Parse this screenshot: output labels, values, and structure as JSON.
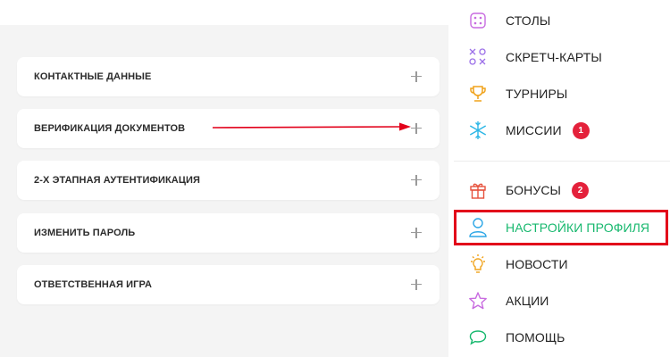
{
  "accordion": [
    {
      "label": "КОНТАКТНЫЕ ДАННЫЕ"
    },
    {
      "label": "ВЕРИФИКАЦИЯ ДОКУМЕНТОВ"
    },
    {
      "label": "2-Х ЭТАПНАЯ АУТЕНТИФИКАЦИЯ"
    },
    {
      "label": "ИЗМЕНИТЬ ПАРОЛЬ"
    },
    {
      "label": "ОТВЕТСТВЕННАЯ ИГРА"
    }
  ],
  "menu": {
    "items": [
      {
        "label": "СТОЛЫ",
        "icon": "dice-icon",
        "color": "#c86be0"
      },
      {
        "label": "СКРЕТЧ-КАРТЫ",
        "icon": "tic-tac-toe-icon",
        "color": "#9b6fe8"
      },
      {
        "label": "ТУРНИРЫ",
        "icon": "trophy-icon",
        "color": "#f0a21a"
      },
      {
        "label": "МИССИИ",
        "icon": "snowflake-icon",
        "color": "#2bb6e6",
        "badge": "1"
      },
      {
        "label": "БОНУСЫ",
        "icon": "gift-icon",
        "color": "#e6503b",
        "badge": "2"
      },
      {
        "label": "НАСТРОЙКИ ПРОФИЛЯ",
        "icon": "user-icon",
        "color": "#2ba6e6",
        "active": true
      },
      {
        "label": "НОВОСТИ",
        "icon": "lightbulb-icon",
        "color": "#f0a21a"
      },
      {
        "label": "АКЦИИ",
        "icon": "star-icon",
        "color": "#c86be0"
      },
      {
        "label": "ПОМОЩЬ",
        "icon": "chat-bubble-icon",
        "color": "#17b86e"
      }
    ]
  },
  "colors": {
    "highlight_border": "#e2001a",
    "active_text": "#17b86e",
    "badge": "#e4213b",
    "arrow": "#e2001a"
  }
}
